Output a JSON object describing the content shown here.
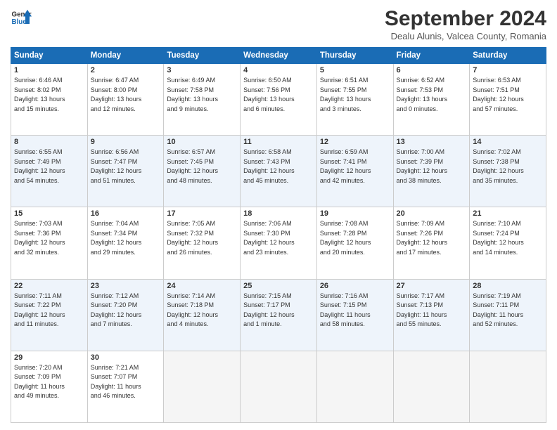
{
  "header": {
    "logo_line1": "General",
    "logo_line2": "Blue",
    "month_title": "September 2024",
    "location": "Dealu Alunis, Valcea County, Romania"
  },
  "weekdays": [
    "Sunday",
    "Monday",
    "Tuesday",
    "Wednesday",
    "Thursday",
    "Friday",
    "Saturday"
  ],
  "weeks": [
    [
      {
        "day": "1",
        "info": "Sunrise: 6:46 AM\nSunset: 8:02 PM\nDaylight: 13 hours\nand 15 minutes."
      },
      {
        "day": "2",
        "info": "Sunrise: 6:47 AM\nSunset: 8:00 PM\nDaylight: 13 hours\nand 12 minutes."
      },
      {
        "day": "3",
        "info": "Sunrise: 6:49 AM\nSunset: 7:58 PM\nDaylight: 13 hours\nand 9 minutes."
      },
      {
        "day": "4",
        "info": "Sunrise: 6:50 AM\nSunset: 7:56 PM\nDaylight: 13 hours\nand 6 minutes."
      },
      {
        "day": "5",
        "info": "Sunrise: 6:51 AM\nSunset: 7:55 PM\nDaylight: 13 hours\nand 3 minutes."
      },
      {
        "day": "6",
        "info": "Sunrise: 6:52 AM\nSunset: 7:53 PM\nDaylight: 13 hours\nand 0 minutes."
      },
      {
        "day": "7",
        "info": "Sunrise: 6:53 AM\nSunset: 7:51 PM\nDaylight: 12 hours\nand 57 minutes."
      }
    ],
    [
      {
        "day": "8",
        "info": "Sunrise: 6:55 AM\nSunset: 7:49 PM\nDaylight: 12 hours\nand 54 minutes."
      },
      {
        "day": "9",
        "info": "Sunrise: 6:56 AM\nSunset: 7:47 PM\nDaylight: 12 hours\nand 51 minutes."
      },
      {
        "day": "10",
        "info": "Sunrise: 6:57 AM\nSunset: 7:45 PM\nDaylight: 12 hours\nand 48 minutes."
      },
      {
        "day": "11",
        "info": "Sunrise: 6:58 AM\nSunset: 7:43 PM\nDaylight: 12 hours\nand 45 minutes."
      },
      {
        "day": "12",
        "info": "Sunrise: 6:59 AM\nSunset: 7:41 PM\nDaylight: 12 hours\nand 42 minutes."
      },
      {
        "day": "13",
        "info": "Sunrise: 7:00 AM\nSunset: 7:39 PM\nDaylight: 12 hours\nand 38 minutes."
      },
      {
        "day": "14",
        "info": "Sunrise: 7:02 AM\nSunset: 7:38 PM\nDaylight: 12 hours\nand 35 minutes."
      }
    ],
    [
      {
        "day": "15",
        "info": "Sunrise: 7:03 AM\nSunset: 7:36 PM\nDaylight: 12 hours\nand 32 minutes."
      },
      {
        "day": "16",
        "info": "Sunrise: 7:04 AM\nSunset: 7:34 PM\nDaylight: 12 hours\nand 29 minutes."
      },
      {
        "day": "17",
        "info": "Sunrise: 7:05 AM\nSunset: 7:32 PM\nDaylight: 12 hours\nand 26 minutes."
      },
      {
        "day": "18",
        "info": "Sunrise: 7:06 AM\nSunset: 7:30 PM\nDaylight: 12 hours\nand 23 minutes."
      },
      {
        "day": "19",
        "info": "Sunrise: 7:08 AM\nSunset: 7:28 PM\nDaylight: 12 hours\nand 20 minutes."
      },
      {
        "day": "20",
        "info": "Sunrise: 7:09 AM\nSunset: 7:26 PM\nDaylight: 12 hours\nand 17 minutes."
      },
      {
        "day": "21",
        "info": "Sunrise: 7:10 AM\nSunset: 7:24 PM\nDaylight: 12 hours\nand 14 minutes."
      }
    ],
    [
      {
        "day": "22",
        "info": "Sunrise: 7:11 AM\nSunset: 7:22 PM\nDaylight: 12 hours\nand 11 minutes."
      },
      {
        "day": "23",
        "info": "Sunrise: 7:12 AM\nSunset: 7:20 PM\nDaylight: 12 hours\nand 7 minutes."
      },
      {
        "day": "24",
        "info": "Sunrise: 7:14 AM\nSunset: 7:18 PM\nDaylight: 12 hours\nand 4 minutes."
      },
      {
        "day": "25",
        "info": "Sunrise: 7:15 AM\nSunset: 7:17 PM\nDaylight: 12 hours\nand 1 minute."
      },
      {
        "day": "26",
        "info": "Sunrise: 7:16 AM\nSunset: 7:15 PM\nDaylight: 11 hours\nand 58 minutes."
      },
      {
        "day": "27",
        "info": "Sunrise: 7:17 AM\nSunset: 7:13 PM\nDaylight: 11 hours\nand 55 minutes."
      },
      {
        "day": "28",
        "info": "Sunrise: 7:19 AM\nSunset: 7:11 PM\nDaylight: 11 hours\nand 52 minutes."
      }
    ],
    [
      {
        "day": "29",
        "info": "Sunrise: 7:20 AM\nSunset: 7:09 PM\nDaylight: 11 hours\nand 49 minutes."
      },
      {
        "day": "30",
        "info": "Sunrise: 7:21 AM\nSunset: 7:07 PM\nDaylight: 11 hours\nand 46 minutes."
      },
      null,
      null,
      null,
      null,
      null
    ]
  ]
}
